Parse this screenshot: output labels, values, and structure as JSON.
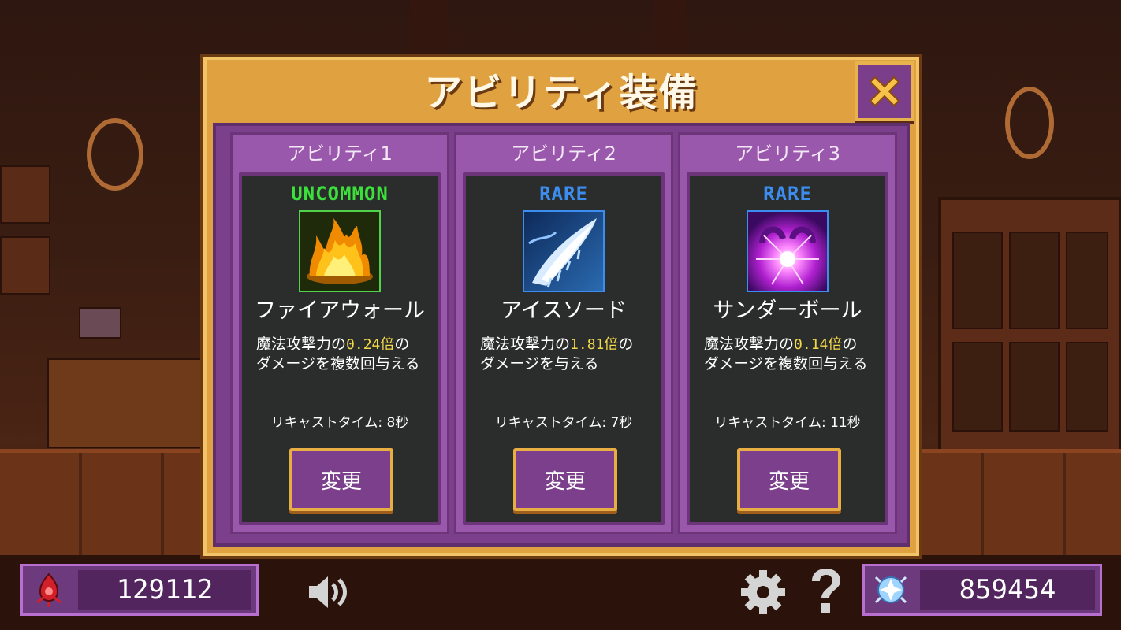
{
  "dialog": {
    "title": "アビリティ装備",
    "close_icon": "close-x-icon"
  },
  "slots": [
    {
      "label": "アビリティ1",
      "rarity": "UNCOMMON",
      "rarity_color": "#3be03a",
      "icon": "fire-wall-icon",
      "name": "ファイアウォール",
      "desc_prefix": "魔法攻撃力の",
      "multiplier": "0.24倍",
      "desc_suffix": "のダメージを複数回与える",
      "recast": "リキャストタイム: 8秒",
      "button": "変更"
    },
    {
      "label": "アビリティ2",
      "rarity": "RARE",
      "rarity_color": "#3b8ef0",
      "icon": "ice-sword-icon",
      "name": "アイスソード",
      "desc_prefix": "魔法攻撃力の",
      "multiplier": "1.81倍",
      "desc_suffix": "のダメージを与える",
      "recast": "リキャストタイム: 7秒",
      "button": "変更"
    },
    {
      "label": "アビリティ3",
      "rarity": "RARE",
      "rarity_color": "#3b8ef0",
      "icon": "thunder-ball-icon",
      "name": "サンダーボール",
      "desc_prefix": "魔法攻撃力の",
      "multiplier": "0.14倍",
      "desc_suffix": "のダメージを複数回与える",
      "recast": "リキャストタイム: 11秒",
      "button": "変更"
    }
  ],
  "hud": {
    "left_currency": {
      "icon": "red-soul-icon",
      "value": "129112"
    },
    "right_currency": {
      "icon": "crystal-orb-icon",
      "value": "859454"
    },
    "sound_icon": "speaker-icon",
    "settings_icon": "gear-icon",
    "help_icon": "question-icon"
  }
}
